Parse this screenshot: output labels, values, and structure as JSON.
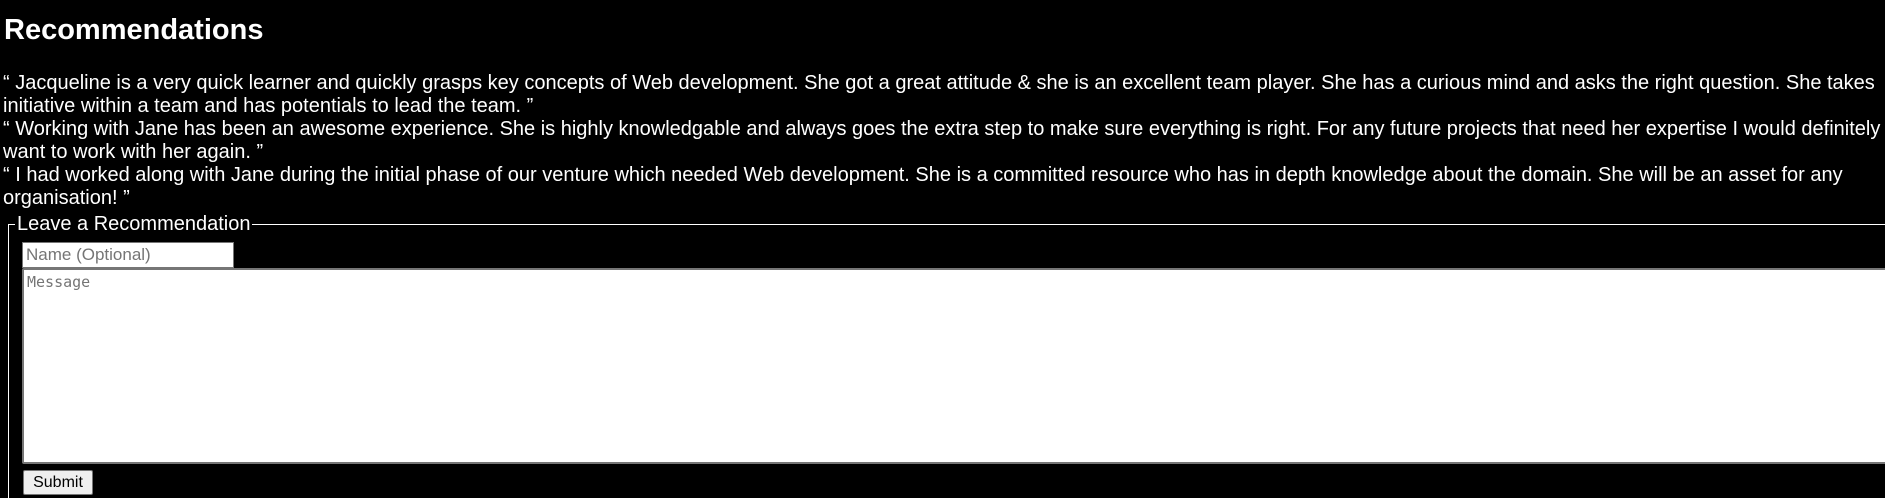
{
  "section": {
    "title": "Recommendations"
  },
  "recommendations": [
    {
      "text": "“ Jacqueline is a very quick learner and quickly grasps key concepts of Web development. She got a great attitude & she is an excellent team player. She has a curious mind and asks the right question. She takes initiative within a team and has potentials to lead the team. ”"
    },
    {
      "text": "“ Working with Jane has been an awesome experience. She is highly knowledgable and always goes the extra step to make sure everything is right. For any future projects that need her expertise I would definitely want to work with her again. ”"
    },
    {
      "text": "“ I had worked along with Jane during the initial phase of our venture which needed Web development. She is a committed resource who has in depth knowledge about the domain. She will be an asset for any organisation! ”"
    }
  ],
  "form": {
    "legend": "Leave a Recommendation",
    "name_placeholder": "Name (Optional)",
    "name_value": "",
    "message_placeholder": "Message",
    "message_value": "",
    "submit_label": "Submit"
  },
  "colors": {
    "background": "#000000",
    "text": "#ffffff",
    "input_background": "#ffffff",
    "button_background": "#efefef"
  }
}
